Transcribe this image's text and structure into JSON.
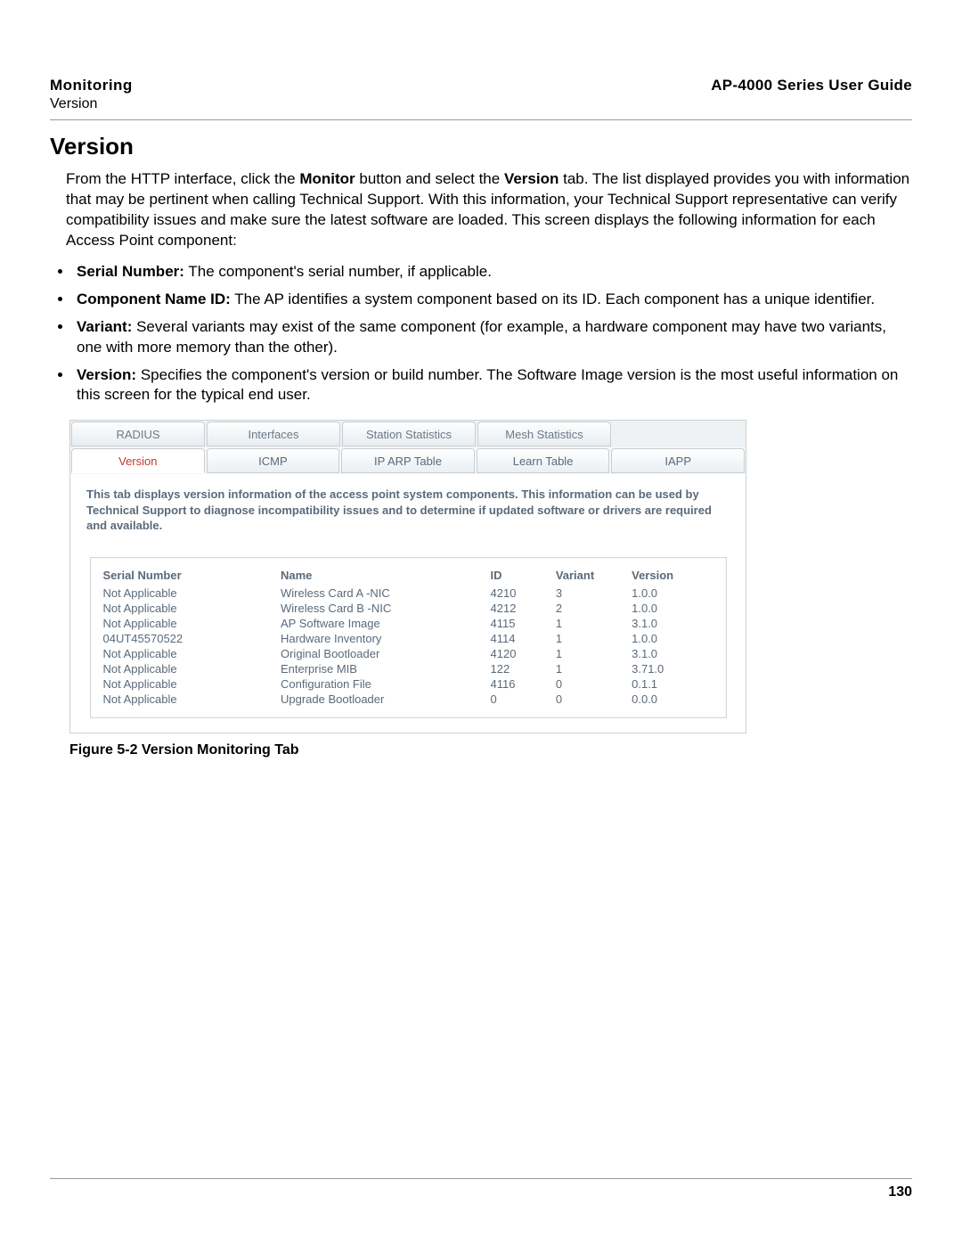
{
  "header": {
    "left_title": "Monitoring",
    "left_sub": "Version",
    "right": "AP-4000 Series User Guide"
  },
  "section": {
    "title": "Version",
    "intro_pre": "From the HTTP interface, click the ",
    "intro_b1": "Monitor",
    "intro_mid": " button and select the ",
    "intro_b2": "Version",
    "intro_post": " tab. The list displayed provides you with information that may be pertinent when calling Technical Support. With this information, your Technical Support representative can verify compatibility issues and make sure the latest software are loaded. This screen displays the following information for each Access Point component:"
  },
  "bullets": [
    {
      "label": "Serial Number:",
      "text": " The component's serial number, if applicable."
    },
    {
      "label": "Component Name ID:",
      "text": " The AP identifies a system component based on its ID. Each component has a unique identifier."
    },
    {
      "label": "Variant:",
      "text": " Several variants may exist of the same component (for example, a hardware component may have two variants, one with more memory than the other)."
    },
    {
      "label": "Version:",
      "text": " Specifies the component's version or build number. The Software Image version is the most useful information on this screen for the typical end user."
    }
  ],
  "panel": {
    "upper_tabs": [
      "RADIUS",
      "Interfaces",
      "Station Statistics",
      "Mesh Statistics",
      ""
    ],
    "lower_tabs": [
      "Version",
      "ICMP",
      "IP ARP Table",
      "Learn Table",
      "IAPP"
    ],
    "active_lower_index": 0,
    "description": "This tab displays version information of the access point system components. This information can be used by Technical Support to diagnose incompatibility issues and to determine if updated software or drivers are required and available.",
    "columns": [
      "Serial Number",
      "Name",
      "ID",
      "Variant",
      "Version"
    ],
    "rows": [
      {
        "serial": "Not Applicable",
        "name": "Wireless Card A -NIC",
        "id": "4210",
        "variant": "3",
        "version": "1.0.0"
      },
      {
        "serial": "Not Applicable",
        "name": "Wireless Card B -NIC",
        "id": "4212",
        "variant": "2",
        "version": "1.0.0"
      },
      {
        "serial": "Not Applicable",
        "name": "AP Software Image",
        "id": "4115",
        "variant": "1",
        "version": "3.1.0"
      },
      {
        "serial": "04UT45570522",
        "name": "Hardware Inventory",
        "id": "4114",
        "variant": "1",
        "version": "1.0.0"
      },
      {
        "serial": "Not Applicable",
        "name": "Original Bootloader",
        "id": "4120",
        "variant": "1",
        "version": "3.1.0"
      },
      {
        "serial": "Not Applicable",
        "name": "Enterprise MIB",
        "id": "122",
        "variant": "1",
        "version": "3.71.0"
      },
      {
        "serial": "Not Applicable",
        "name": "Configuration File",
        "id": "4116",
        "variant": "0",
        "version": "0.1.1"
      },
      {
        "serial": "Not Applicable",
        "name": "Upgrade Bootloader",
        "id": "0",
        "variant": "0",
        "version": "0.0.0"
      }
    ]
  },
  "figure_caption": "Figure 5-2 Version Monitoring Tab",
  "page_number": "130"
}
